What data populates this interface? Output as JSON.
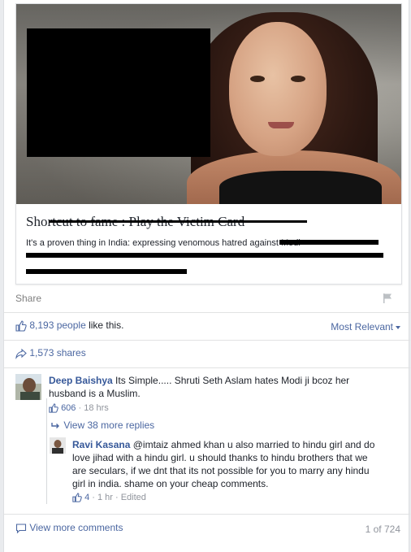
{
  "link_preview": {
    "title": "Shortcut to fame : Play the Victim Card",
    "description": "It's a proven thing in India: expressing venomous hatred against Modi"
  },
  "actions": {
    "share_label": "Share"
  },
  "likes": {
    "count_text": "8,193 people",
    "suffix": " like this.",
    "sort_label": "Most Relevant"
  },
  "shares": {
    "label": "1,573 shares"
  },
  "comments": [
    {
      "author": "Deep Baishya",
      "text": "Its Simple..... Shruti Seth Aslam hates Modi ji bcoz her husband is a Muslim.",
      "likes": "606",
      "time": "18 hrs"
    }
  ],
  "view_replies_label": "View 38 more replies",
  "reply": {
    "author": "Ravi Kasana",
    "text": "@imtaiz ahmed khan u also married to hindu girl and do love jihad with a hindu girl. u should thanks to hindu brothers that we are seculars, if we dnt that its not possible for you to marry any hindu girl in india. shame on your cheap comments.",
    "likes": "4",
    "time": "1 hr",
    "edited": "Edited"
  },
  "footer": {
    "view_more_label": "View more comments",
    "page_count": "1 of 724"
  },
  "colors": {
    "link": "#4b67a1",
    "author": "#365899",
    "meta": "#90949c"
  }
}
